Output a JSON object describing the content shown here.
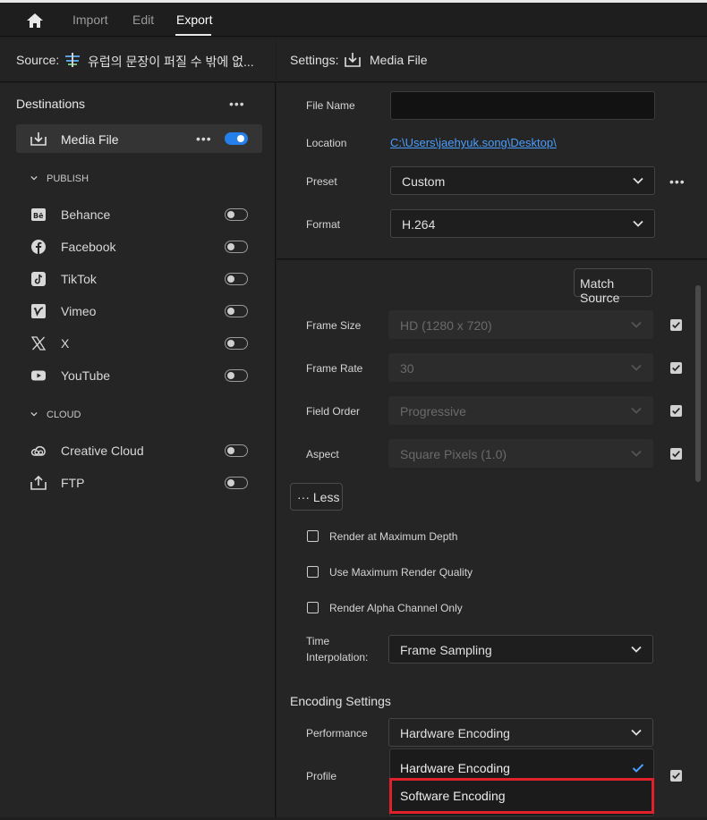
{
  "topbar": {
    "home_icon": "home-icon",
    "tabs": [
      {
        "label": "Import"
      },
      {
        "label": "Edit"
      },
      {
        "label": "Export"
      }
    ],
    "active_tab": "Export"
  },
  "source": {
    "label": "Source:",
    "name": "유럽의 문장이 퍼질 수 밖에 없..."
  },
  "destinations": {
    "title": "Destinations",
    "more": "•••",
    "media_file": {
      "label": "Media File",
      "more": "•••",
      "enabled": true
    },
    "publish_header": "PUBLISH",
    "publish_items": [
      {
        "label": "Behance",
        "icon": "behance-icon"
      },
      {
        "label": "Facebook",
        "icon": "facebook-icon"
      },
      {
        "label": "TikTok",
        "icon": "tiktok-icon"
      },
      {
        "label": "Vimeo",
        "icon": "vimeo-icon"
      },
      {
        "label": "X",
        "icon": "x-icon"
      },
      {
        "label": "YouTube",
        "icon": "youtube-icon"
      }
    ],
    "cloud_header": "CLOUD",
    "cloud_items": [
      {
        "label": "Creative Cloud",
        "icon": "creative-cloud-icon"
      },
      {
        "label": "FTP",
        "icon": "ftp-icon"
      }
    ]
  },
  "settings": {
    "label": "Settings:",
    "target": "Media File",
    "file_name_label": "File Name",
    "file_name_value": "",
    "location_label": "Location",
    "location_value": "C:\\Users\\jaehyuk.song\\Desktop\\",
    "preset_label": "Preset",
    "preset_value": "Custom",
    "preset_more": "•••",
    "format_label": "Format",
    "format_value": "H.264"
  },
  "video": {
    "match_source": "Match Source",
    "frame_size_label": "Frame Size",
    "frame_size_value": "HD (1280 x 720)",
    "frame_rate_label": "Frame Rate",
    "frame_rate_value": "30",
    "field_order_label": "Field Order",
    "field_order_value": "Progressive",
    "aspect_label": "Aspect",
    "aspect_value": "Square Pixels (1.0)",
    "less_button": "··· Less",
    "render_max_depth": "Render at Maximum Depth",
    "max_render_quality": "Use Maximum Render Quality",
    "render_alpha": "Render Alpha Channel Only",
    "time_interp_label_1": "Time",
    "time_interp_label_2": "Interpolation:",
    "time_interp_value": "Frame Sampling"
  },
  "encoding": {
    "title": "Encoding Settings",
    "performance_label": "Performance",
    "performance_value": "Hardware Encoding",
    "profile_label": "Profile",
    "menu_options": [
      "Hardware Encoding",
      "Software Encoding"
    ],
    "selected_option": "Hardware Encoding",
    "highlighted_option": "Software Encoding"
  },
  "colors": {
    "accent": "#2680eb",
    "link": "#4a9eff",
    "highlight": "#e0202a"
  }
}
